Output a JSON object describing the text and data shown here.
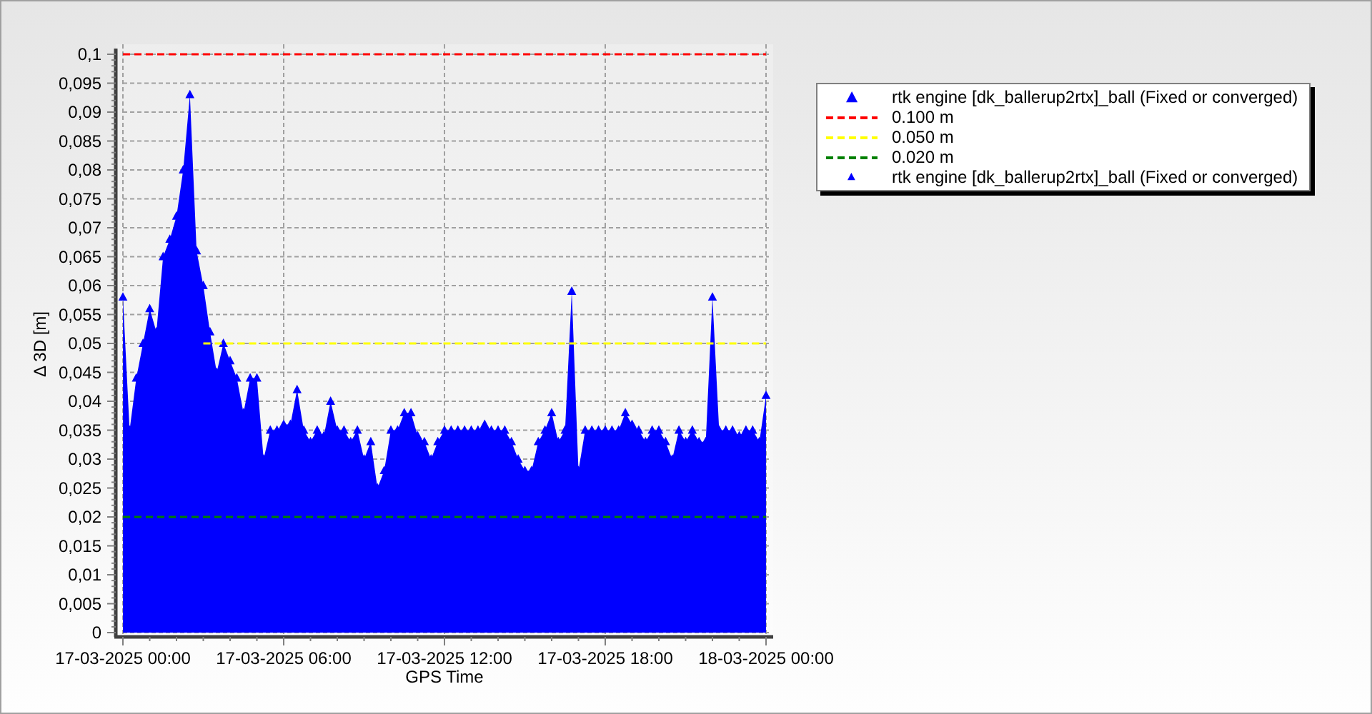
{
  "chart_data": {
    "type": "scatter",
    "grid": true,
    "xlabel": "GPS Time",
    "ylabel": "Δ 3D [m]",
    "ylim": [
      0,
      0.1
    ],
    "categories": [
      "17-03-2025 00:00",
      null,
      null,
      null,
      null,
      null,
      null,
      null,
      null,
      null,
      null,
      null,
      null,
      null,
      null,
      null,
      null,
      null,
      null,
      null,
      null,
      null,
      null,
      null,
      "17-03-2025 06:00",
      null,
      null,
      null,
      null,
      null,
      null,
      null,
      null,
      null,
      null,
      null,
      null,
      null,
      null,
      null,
      null,
      null,
      null,
      null,
      null,
      null,
      null,
      null,
      "17-03-2025 12:00",
      null,
      null,
      null,
      null,
      null,
      null,
      null,
      null,
      null,
      null,
      null,
      null,
      null,
      null,
      null,
      null,
      null,
      null,
      null,
      null,
      null,
      null,
      null,
      "17-03-2025 18:00",
      null,
      null,
      null,
      null,
      null,
      null,
      null,
      null,
      null,
      null,
      null,
      null,
      null,
      null,
      null,
      null,
      null,
      null,
      null,
      null,
      null,
      null,
      null,
      "18-03-2025 00:00"
    ],
    "yticks": [
      {
        "value": 0,
        "label": "0"
      },
      {
        "value": 0.005,
        "label": "0,005"
      },
      {
        "value": 0.01,
        "label": "0,01"
      },
      {
        "value": 0.015,
        "label": "0,015"
      },
      {
        "value": 0.02,
        "label": "0,02"
      },
      {
        "value": 0.025,
        "label": "0,025"
      },
      {
        "value": 0.03,
        "label": "0,03"
      },
      {
        "value": 0.035,
        "label": "0,035"
      },
      {
        "value": 0.04,
        "label": "0,04"
      },
      {
        "value": 0.045,
        "label": "0,045"
      },
      {
        "value": 0.05,
        "label": "0,05"
      },
      {
        "value": 0.055,
        "label": "0,055"
      },
      {
        "value": 0.06,
        "label": "0,06"
      },
      {
        "value": 0.065,
        "label": "0,065"
      },
      {
        "value": 0.07,
        "label": "0,07"
      },
      {
        "value": 0.075,
        "label": "0,075"
      },
      {
        "value": 0.08,
        "label": "0,08"
      },
      {
        "value": 0.085,
        "label": "0,085"
      },
      {
        "value": 0.09,
        "label": "0,09"
      },
      {
        "value": 0.095,
        "label": "0,095"
      },
      {
        "value": 0.1,
        "label": "0,1"
      }
    ],
    "series": [
      {
        "type": "area",
        "name": "rtk engine [dk_ballerup2rtx]_ball (Fixed or converged)",
        "color": "#0000ff",
        "values": [
          0.058,
          0.035,
          0.044,
          0.05,
          0.056,
          0.052,
          0.065,
          0.068,
          0.072,
          0.08,
          0.093,
          0.066,
          0.06,
          0.052,
          0.045,
          0.05,
          0.047,
          0.044,
          0.038,
          0.044,
          0.044,
          0.03,
          0.035,
          0.035,
          0.036,
          0.036,
          0.042,
          0.035,
          0.033,
          0.035,
          0.034,
          0.04,
          0.035,
          0.035,
          0.033,
          0.035,
          0.03,
          0.033,
          0.025,
          0.028,
          0.035,
          0.035,
          0.038,
          0.038,
          0.034,
          0.033,
          0.03,
          0.033,
          0.035,
          0.035,
          0.035,
          0.035,
          0.035,
          0.035,
          0.036,
          0.035,
          0.035,
          0.035,
          0.033,
          0.03,
          0.028,
          0.028,
          0.033,
          0.035,
          0.038,
          0.033,
          0.035,
          0.059,
          0.028,
          0.035,
          0.035,
          0.035,
          0.035,
          0.035,
          0.035,
          0.038,
          0.036,
          0.035,
          0.033,
          0.035,
          0.035,
          0.033,
          0.03,
          0.035,
          0.033,
          0.035,
          0.033,
          0.033,
          0.058,
          0.035,
          0.035,
          0.035,
          0.034,
          0.035,
          0.035,
          0.033,
          0.041
        ]
      },
      {
        "type": "line",
        "line_style": "dashed",
        "name": "0.100 m",
        "color": "#ff0000",
        "values": [
          0.1,
          0.1,
          0.1,
          0.1,
          0.1,
          0.1,
          0.1,
          0.1,
          0.1,
          0.1,
          0.1,
          0.1,
          0.1,
          0.1,
          0.1,
          0.1,
          0.1,
          0.1,
          0.1,
          0.1,
          0.1,
          0.1,
          0.1,
          0.1,
          0.1,
          0.1,
          0.1,
          0.1,
          0.1,
          0.1,
          0.1,
          0.1,
          0.1,
          0.1,
          0.1,
          0.1,
          0.1,
          0.1,
          0.1,
          0.1,
          0.1,
          0.1,
          0.1,
          0.1,
          0.1,
          0.1,
          0.1,
          0.1,
          0.1,
          0.1,
          0.1,
          0.1,
          0.1,
          0.1,
          0.1,
          0.1,
          0.1,
          0.1,
          0.1,
          0.1,
          0.1,
          0.1,
          0.1,
          0.1,
          0.1,
          0.1,
          0.1,
          0.1,
          0.1,
          0.1,
          0.1,
          0.1,
          0.1,
          0.1,
          0.1,
          0.1,
          0.1,
          0.1,
          0.1,
          0.1,
          0.1,
          0.1,
          0.1,
          0.1,
          0.1,
          0.1,
          0.1,
          0.1,
          0.1,
          0.1,
          0.1,
          0.1,
          0.1,
          0.1,
          0.1,
          0.1,
          0.1
        ]
      },
      {
        "type": "line",
        "line_style": "dashed",
        "name": "0.050 m",
        "color": "#ffff00",
        "values": [
          null,
          null,
          null,
          null,
          null,
          null,
          null,
          null,
          null,
          null,
          null,
          null,
          0.05,
          0.05,
          0.05,
          0.05,
          0.05,
          0.05,
          0.05,
          0.05,
          0.05,
          0.05,
          0.05,
          0.05,
          0.05,
          0.05,
          0.05,
          0.05,
          0.05,
          0.05,
          0.05,
          0.05,
          0.05,
          0.05,
          0.05,
          0.05,
          0.05,
          0.05,
          0.05,
          0.05,
          0.05,
          0.05,
          0.05,
          0.05,
          0.05,
          0.05,
          0.05,
          0.05,
          0.05,
          0.05,
          0.05,
          0.05,
          0.05,
          0.05,
          0.05,
          0.05,
          0.05,
          0.05,
          0.05,
          0.05,
          0.05,
          0.05,
          0.05,
          0.05,
          0.05,
          0.05,
          0.05,
          0.05,
          0.05,
          0.05,
          0.05,
          0.05,
          0.05,
          0.05,
          0.05,
          0.05,
          0.05,
          0.05,
          0.05,
          0.05,
          0.05,
          0.05,
          0.05,
          0.05,
          0.05,
          0.05,
          0.05,
          0.05,
          0.05,
          0.05,
          0.05,
          0.05,
          0.05,
          0.05,
          0.05,
          0.05,
          0.05
        ]
      },
      {
        "type": "line",
        "line_style": "dashed",
        "name": "0.020 m",
        "color": "#008000",
        "values": [
          0.02,
          0.02,
          0.02,
          0.02,
          0.02,
          0.02,
          0.02,
          0.02,
          0.02,
          0.02,
          0.02,
          0.02,
          0.02,
          0.02,
          0.02,
          0.02,
          0.02,
          0.02,
          0.02,
          0.02,
          0.02,
          0.02,
          0.02,
          0.02,
          0.02,
          0.02,
          0.02,
          0.02,
          0.02,
          0.02,
          0.02,
          0.02,
          0.02,
          0.02,
          0.02,
          0.02,
          0.02,
          0.02,
          0.02,
          0.02,
          0.02,
          0.02,
          0.02,
          0.02,
          0.02,
          0.02,
          0.02,
          0.02,
          0.02,
          0.02,
          0.02,
          0.02,
          0.02,
          0.02,
          0.02,
          0.02,
          0.02,
          0.02,
          0.02,
          0.02,
          0.02,
          0.02,
          0.02,
          0.02,
          0.02,
          0.02,
          0.02,
          0.02,
          0.02,
          0.02,
          0.02,
          0.02,
          0.02,
          0.02,
          0.02,
          0.02,
          0.02,
          0.02,
          0.02,
          0.02,
          0.02,
          0.02,
          0.02,
          0.02,
          0.02,
          0.02,
          0.02,
          0.02,
          0.02,
          0.02,
          0.02,
          0.02,
          0.02,
          0.02,
          0.02,
          0.02,
          0.02
        ]
      },
      {
        "type": "scatter",
        "name": "rtk engine [dk_ballerup2rtx]_ball (Fixed or converged)",
        "color": "#0000ff",
        "values": [
          null,
          null,
          null,
          null,
          null,
          null,
          null,
          null,
          null,
          null,
          null,
          null,
          null,
          null,
          null,
          null,
          null,
          null,
          null,
          null,
          null,
          null,
          null,
          null,
          null,
          null,
          null,
          null,
          null,
          null,
          null,
          null,
          null,
          null,
          null,
          null,
          null,
          null,
          null,
          null,
          null,
          null,
          null,
          null,
          null,
          null,
          null,
          null,
          null,
          null,
          null,
          null,
          null,
          null,
          null,
          null,
          null,
          null,
          null,
          null,
          null,
          null,
          null,
          null,
          null,
          null,
          null,
          null,
          null,
          null,
          null,
          null,
          null,
          null,
          null,
          null,
          null,
          null,
          null,
          null,
          null,
          null,
          null,
          null,
          null,
          null,
          null,
          null,
          null,
          null,
          null,
          null,
          null,
          null,
          null,
          null,
          null
        ]
      }
    ]
  }
}
